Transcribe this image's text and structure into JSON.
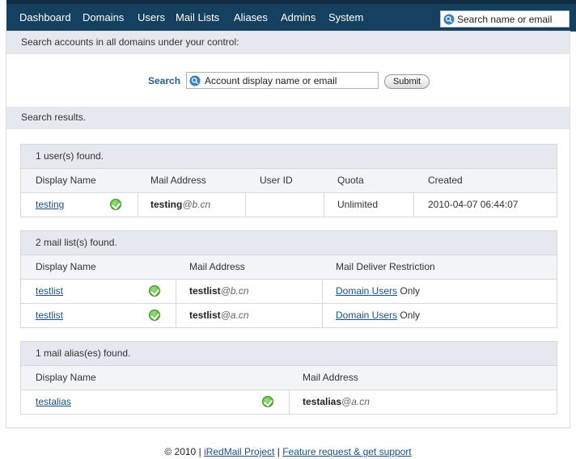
{
  "nav": {
    "items": [
      "Dashboard",
      "Domains",
      "Users",
      "Mail Lists",
      "Aliases",
      "Admins",
      "System"
    ],
    "search_placeholder": "Search name or email"
  },
  "search": {
    "intro": "Search accounts in all domains under your control:",
    "label": "Search",
    "placeholder": "Account display name or email",
    "submit": "Submit",
    "results_heading": "Search results."
  },
  "users": {
    "title": "1 user(s) found.",
    "columns": [
      "Display Name",
      "Mail Address",
      "User ID",
      "Quota",
      "Created"
    ],
    "rows": [
      {
        "name": "testing",
        "email_user": "testing",
        "email_domain": "@b.cn",
        "user_id": "",
        "quota": "Unlimited",
        "created": "2010-04-07 06:44:07"
      }
    ]
  },
  "mail_lists": {
    "title": "2 mail list(s) found.",
    "columns": [
      "Display Name",
      "Mail Address",
      "Mail Deliver Restriction"
    ],
    "rows": [
      {
        "name": "testlist",
        "email_user": "testlist",
        "email_domain": "@b.cn",
        "restriction_link": "Domain Users",
        "restriction_suffix": " Only"
      },
      {
        "name": "testlist",
        "email_user": "testlist",
        "email_domain": "@a.cn",
        "restriction_link": "Domain Users",
        "restriction_suffix": " Only"
      }
    ]
  },
  "aliases": {
    "title": "1 mail alias(es) found.",
    "columns": [
      "Display Name",
      "Mail Address"
    ],
    "rows": [
      {
        "name": "testalias",
        "email_user": "testalias",
        "email_domain": "@a.cn"
      }
    ]
  },
  "footer": {
    "copyright": "© 2010 | ",
    "project_link": "iRedMail Project",
    "separator": " | ",
    "support_link": "Feature request & get support"
  },
  "colors": {
    "nav_bg": "#16405f",
    "link": "#1a4f8b",
    "bar_bg": "#e6e8ef",
    "status_ok": "#3fa525"
  }
}
